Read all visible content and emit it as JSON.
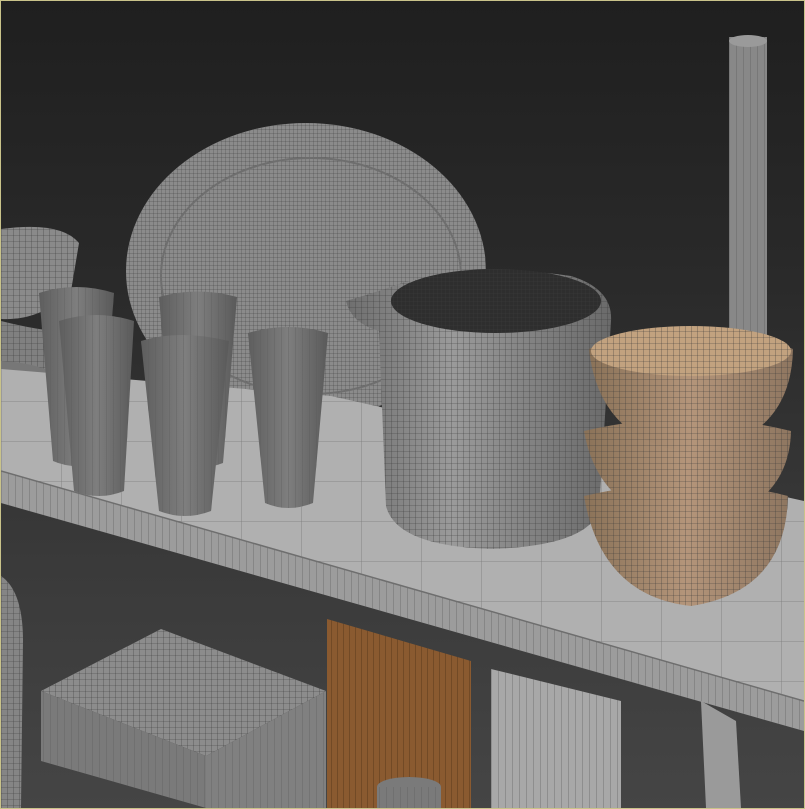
{
  "viewport": {
    "kind": "3d-wireframe-render",
    "border_color": "#c9c38a",
    "background_top": "#1f1f1f",
    "background_bottom": "#454545",
    "wire_color": "#3c3c3c",
    "shelf_color": "#a3a3a3",
    "object_color": "#8e8e8e",
    "glass_color": "#7a7a7a",
    "bowl_color": "#b09070",
    "wood_color": "#8a5a30"
  },
  "objects": [
    "oval-platter",
    "pitcher",
    "stacked-bowls",
    "drinking-glasses",
    "left-bowl-stack",
    "shelf-board",
    "wooden-board",
    "square-plate-stack",
    "upright-pole"
  ]
}
